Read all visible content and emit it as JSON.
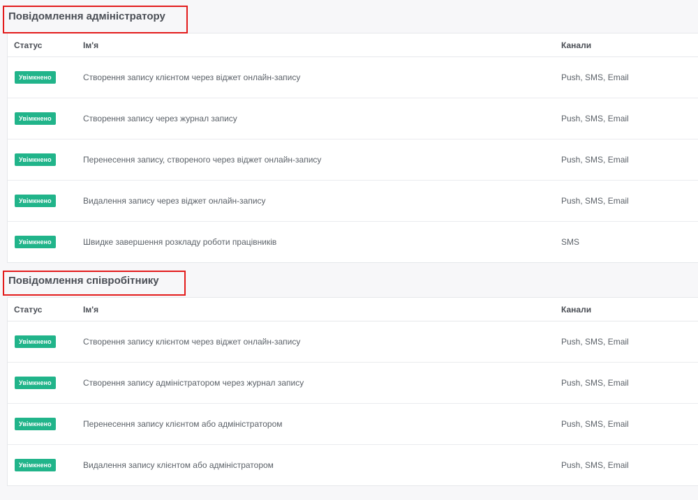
{
  "admin": {
    "title": "Повідомлення адміністратору",
    "headers": {
      "status": "Статус",
      "name": "Ім'я",
      "channels": "Канали"
    },
    "rows": [
      {
        "status": "Увімкнено",
        "name": "Створення запису клієнтом через віджет онлайн-запису",
        "channels": "Push, SMS, Email"
      },
      {
        "status": "Увімкнено",
        "name": "Створення запису через журнал запису",
        "channels": "Push, SMS, Email"
      },
      {
        "status": "Увімкнено",
        "name": "Перенесення запису, створеного через віджет онлайн-запису",
        "channels": "Push, SMS, Email"
      },
      {
        "status": "Увімкнено",
        "name": "Видалення запису через віджет онлайн-запису",
        "channels": "Push, SMS, Email"
      },
      {
        "status": "Увімкнено",
        "name": "Швидке завершення розкладу роботи працівників",
        "channels": "SMS"
      }
    ]
  },
  "employee": {
    "title": "Повідомлення співробітнику",
    "headers": {
      "status": "Статус",
      "name": "Ім'я",
      "channels": "Канали"
    },
    "rows": [
      {
        "status": "Увімкнено",
        "name": "Створення запису клієнтом через віджет онлайн-запису",
        "channels": "Push, SMS, Email"
      },
      {
        "status": "Увімкнено",
        "name": "Створення запису адміністратором через журнал запису",
        "channels": "Push, SMS, Email"
      },
      {
        "status": "Увімкнено",
        "name": "Перенесення запису клієнтом або адміністратором",
        "channels": "Push, SMS, Email"
      },
      {
        "status": "Увімкнено",
        "name": "Видалення запису клієнтом або адміністратором",
        "channels": "Push, SMS, Email"
      }
    ]
  },
  "colors": {
    "badge": "#21b48a",
    "highlight": "#e31b1b"
  }
}
